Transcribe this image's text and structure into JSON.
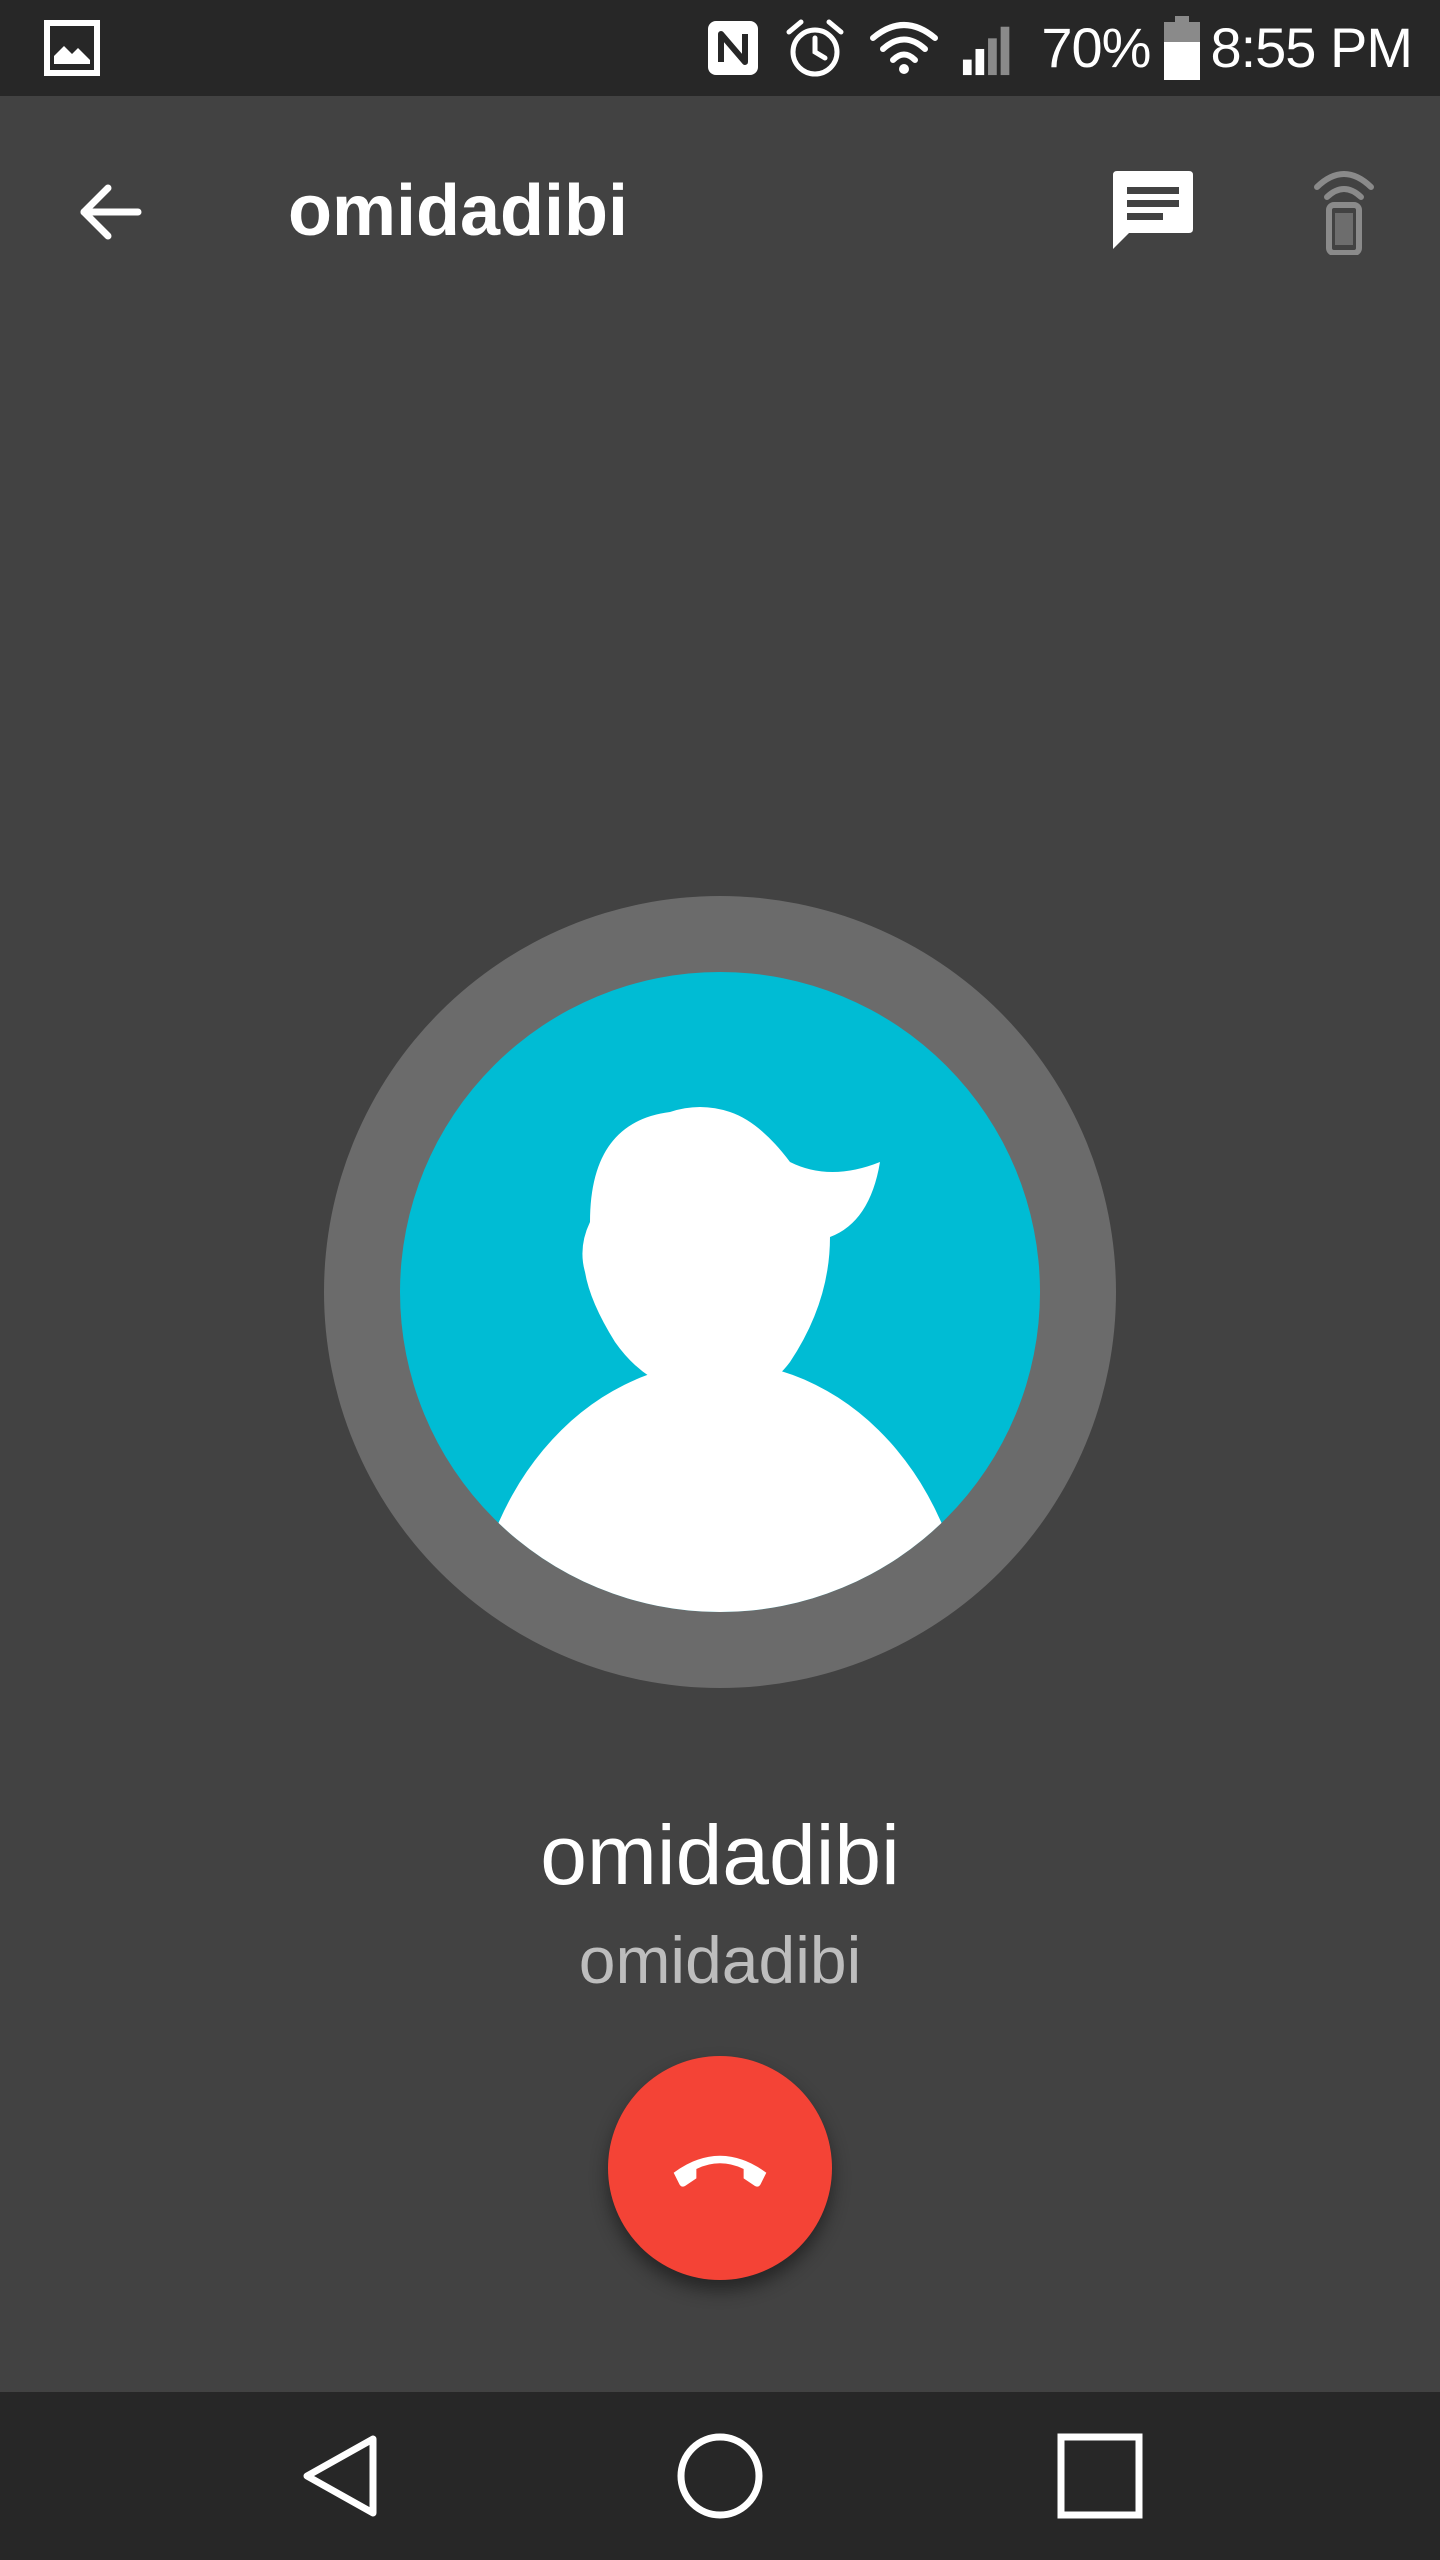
{
  "status_bar": {
    "battery_percent": "70%",
    "time": "8:55 PM",
    "icons": [
      "gallery-icon",
      "nfc-icon",
      "alarm-icon",
      "wifi-icon",
      "signal-icon",
      "battery-icon"
    ]
  },
  "toolbar": {
    "title": "omidadibi",
    "back_icon": "arrow-back-icon",
    "message_icon": "message-icon",
    "phone_remote_icon": "phone-remote-icon"
  },
  "call": {
    "caller_name": "omidadibi",
    "caller_subtitle": "omidadibi",
    "end_call_icon": "call-end-icon"
  },
  "nav_bar": {
    "icons": [
      "back-triangle-icon",
      "home-circle-icon",
      "recents-square-icon"
    ]
  },
  "colors": {
    "background": "#424242",
    "bars": "#272727",
    "avatar_bg": "#00bcd4",
    "avatar_ring": "#6b6b6b",
    "end_call": "#f44336",
    "subtitle": "#bdbdbd"
  }
}
